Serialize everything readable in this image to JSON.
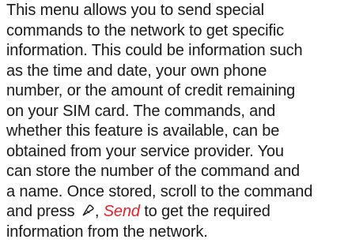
{
  "paragraph": {
    "lines": [
      "This menu allows you to send special",
      "commands to the network to get specific",
      "information. This could be information such",
      "as the time and date, your own phone",
      "number, or the amount of credit remaining",
      "on your SIM card. The commands, and",
      "whether this feature is available, can be",
      "obtained from your service provider. You",
      "can store the number of the command and",
      "a name. Once stored, scroll to the command"
    ],
    "line_11_prefix": "and press ",
    "line_11_separator": ", ",
    "send_label": "Send",
    "line_11_suffix": " to get the required",
    "last_line": "information from the network."
  },
  "softkey_icon": "right-softkey-icon",
  "colors": {
    "text": "#1a1a1a",
    "send_highlight": "#e8202a",
    "background": "#ffffff"
  }
}
